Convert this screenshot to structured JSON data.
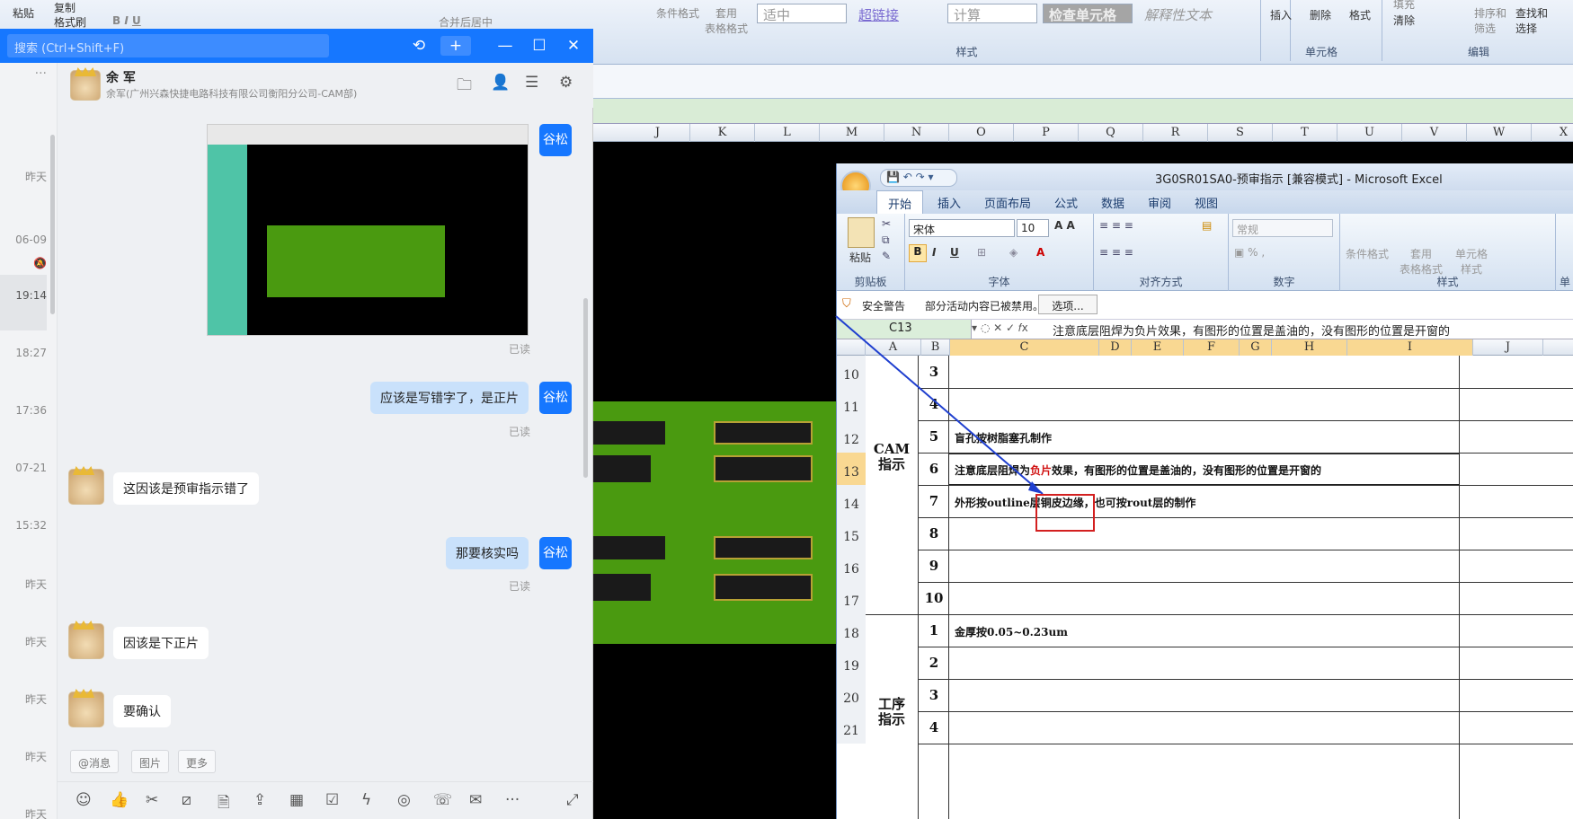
{
  "bg_ribbon": {
    "paste": "粘贴",
    "copy": "复制",
    "format_painter": "格式刷",
    "merge_center": "合并后居中",
    "cond_format": "条件格式",
    "table_format": "套用\n表格格式",
    "style_medium": "适中",
    "style_hyperlink": "超链接",
    "style_calc": "计算",
    "style_check": "检查单元格",
    "style_explain": "解释性文本",
    "styles_label": "样式",
    "insert": "插入",
    "delete": "删除",
    "format": "格式",
    "cells_label": "单元格",
    "fill": "填充",
    "clear": "清除",
    "sort_filter": "排序和\n筛选",
    "find_select": "查找和\n选择",
    "editing_label": "编辑"
  },
  "bg_columns": [
    "J",
    "K",
    "L",
    "M",
    "N",
    "O",
    "P",
    "Q",
    "R",
    "S",
    "T",
    "U",
    "V",
    "W",
    "X"
  ],
  "chat": {
    "search_placeholder": "搜索 (Ctrl+Shift+F)",
    "contact_name": "余 军",
    "contact_sub": "余军(广州兴森快捷电路科技有限公司衡阳分公司-CAM部)",
    "side_times": [
      "昨天",
      "06-09",
      "19:14",
      "18:27",
      "17:36",
      "07-21",
      "15:32",
      "昨天",
      "昨天",
      "昨天",
      "昨天",
      "昨天"
    ],
    "messages": [
      {
        "type": "image",
        "from": "me",
        "sender_tag": "谷松",
        "status": "已读"
      },
      {
        "type": "text",
        "from": "me",
        "text": "应该是写错字了，是正片",
        "sender_tag": "谷松",
        "status": "已读"
      },
      {
        "type": "text",
        "from": "other",
        "text": "这因该是预审指示错了"
      },
      {
        "type": "text",
        "from": "me",
        "text": "那要核实吗",
        "sender_tag": "谷松",
        "status": "已读"
      },
      {
        "type": "text",
        "from": "other",
        "text": "因该是下正片"
      },
      {
        "type": "text",
        "from": "other",
        "text": "要确认"
      }
    ],
    "chips": [
      "@消息",
      "图片",
      "更多"
    ]
  },
  "excel": {
    "title": "3G0SR01SA0-预审指示  [兼容模式] - Microsoft Excel",
    "tabs": [
      "开始",
      "插入",
      "页面布局",
      "公式",
      "数据",
      "审阅",
      "视图"
    ],
    "font_name": "宋体",
    "font_size": "10",
    "number_format": "常规",
    "groups": [
      "剪贴板",
      "字体",
      "对齐方式",
      "数字",
      "样式",
      "单"
    ],
    "paste": "粘贴",
    "cond_format": "条件格式",
    "table_format": "套用\n表格格式",
    "cell_style": "单元格\n样式",
    "security_warning": "安全警告",
    "warning_text": "部分活动内容已被禁用。",
    "options_button": "选项...",
    "name_box": "C13",
    "formula": "注意底层阻焊为负片效果，有图形的位置是盖油的，没有图形的位置是开窗的",
    "columns": [
      "A",
      "B",
      "C",
      "D",
      "E",
      "F",
      "G",
      "H",
      "I",
      "J"
    ],
    "row_numbers": [
      "10",
      "11",
      "12",
      "13",
      "14",
      "15",
      "16",
      "17",
      "18",
      "19",
      "20",
      "21"
    ],
    "section_cam": "CAM\n指示",
    "section_proc": "工序\n指示",
    "rows": [
      {
        "num": "3",
        "text": ""
      },
      {
        "num": "4",
        "text": ""
      },
      {
        "num": "5",
        "text": "盲孔按树脂塞孔制作"
      },
      {
        "num": "6",
        "text_pre": "注意底层阻焊为",
        "text_red": "负片",
        "text_post": "效果，有图形的位置是盖油的，没有图形的位置是开窗的"
      },
      {
        "num": "7",
        "text": "外形按outline层铜皮边缘，也可按rout层的制作"
      },
      {
        "num": "8",
        "text": ""
      },
      {
        "num": "9",
        "text": ""
      },
      {
        "num": "10",
        "text": ""
      },
      {
        "num": "1",
        "text": "金厚按0.05~0.23um"
      },
      {
        "num": "2",
        "text": ""
      },
      {
        "num": "3",
        "text": ""
      },
      {
        "num": "4",
        "text": ""
      }
    ]
  }
}
